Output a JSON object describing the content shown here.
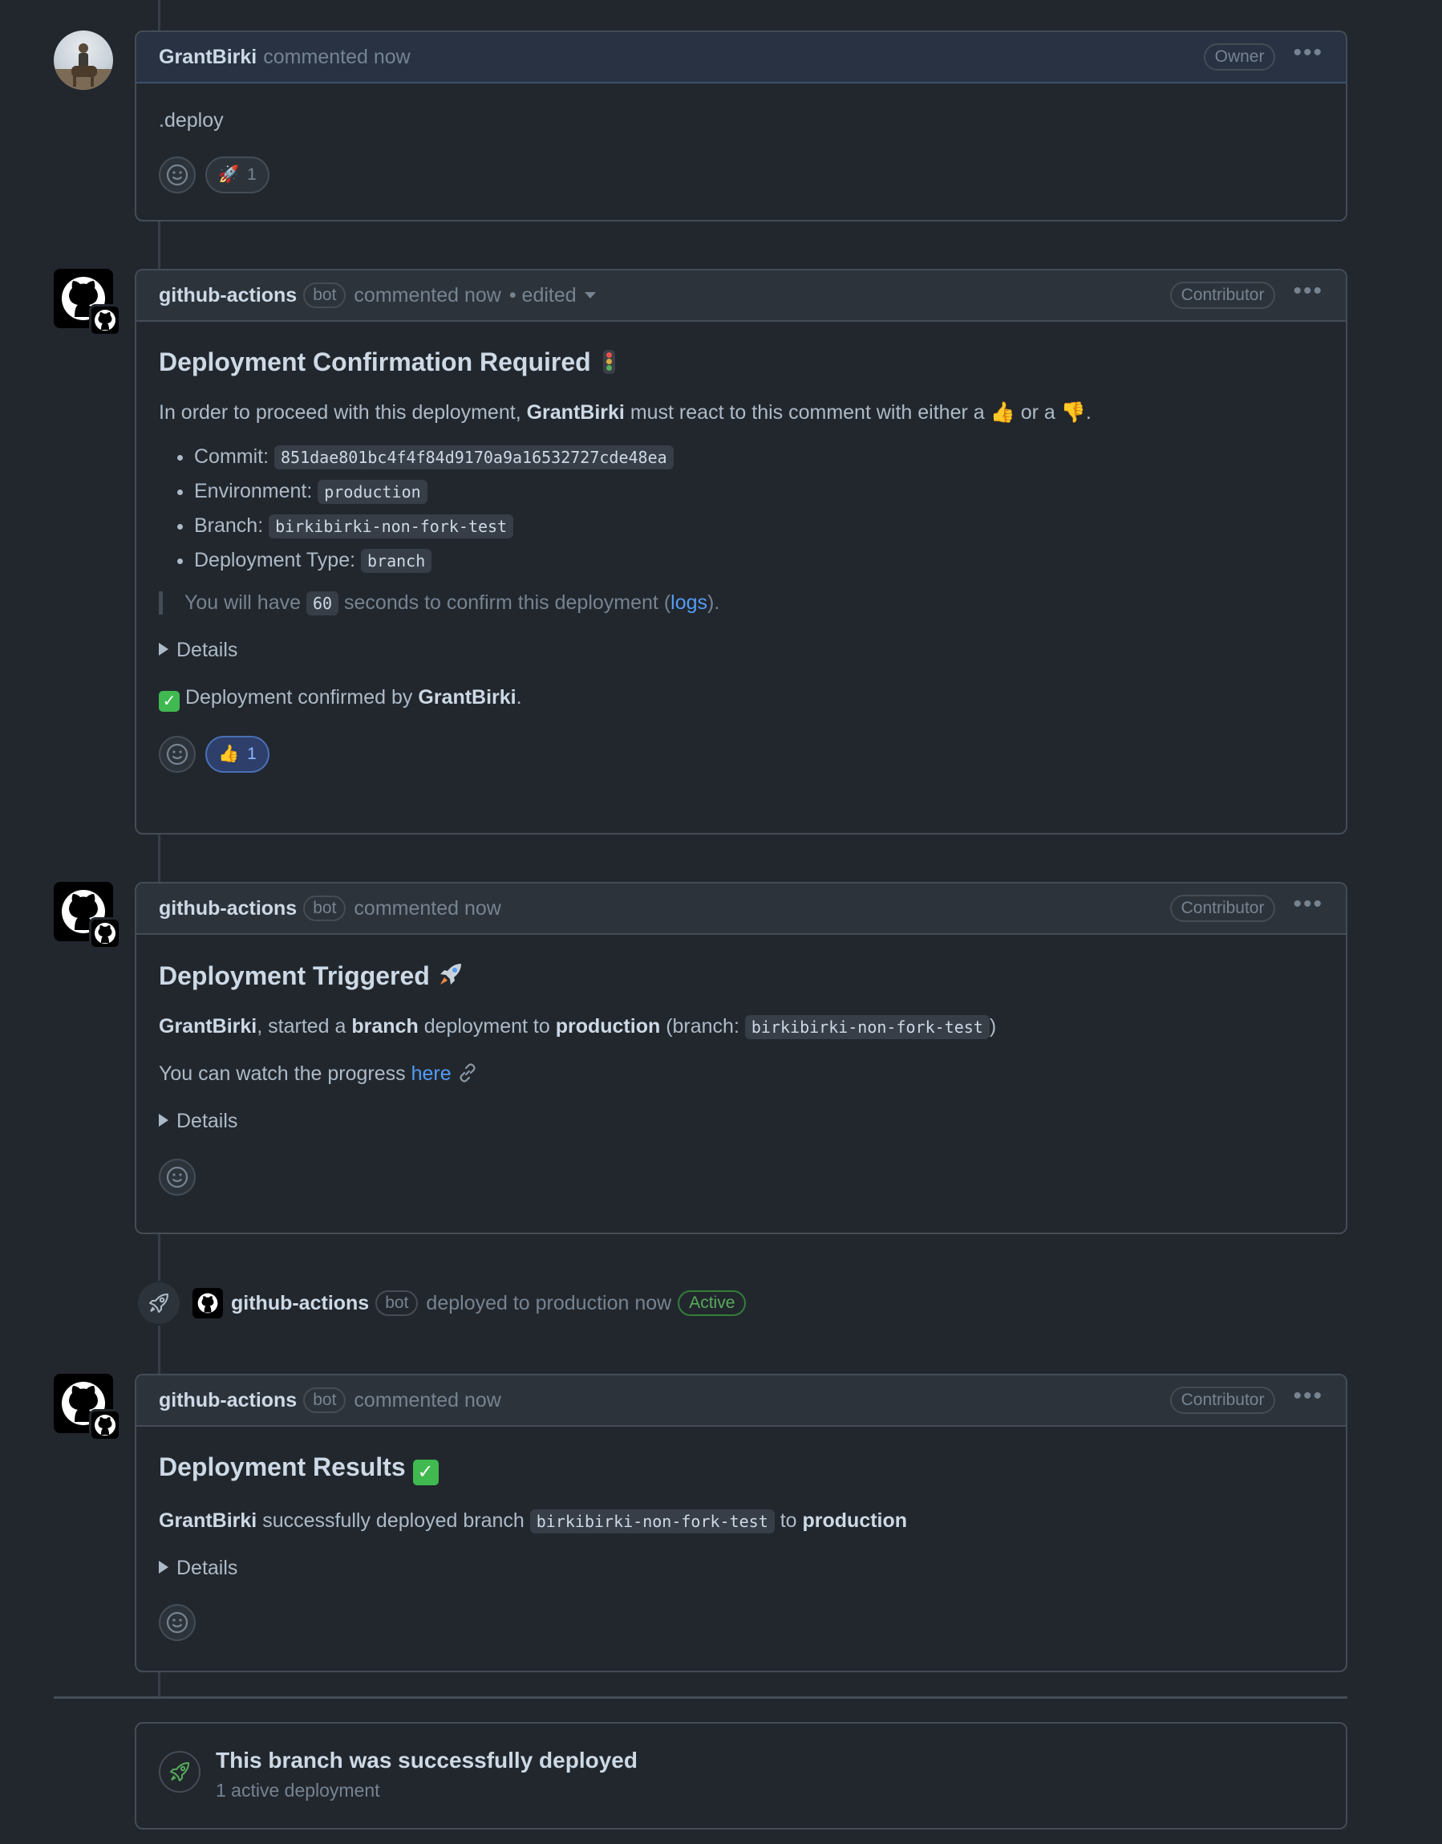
{
  "comments": [
    {
      "author": "GrantBirki",
      "meta": "commented now",
      "role": "Owner",
      "body_text": ".deploy",
      "reaction": {
        "emoji": "🚀",
        "count": "1"
      }
    },
    {
      "author": "github-actions",
      "bot_label": "bot",
      "meta": "commented now",
      "edited": "• edited",
      "role": "Contributor",
      "title": "Deployment Confirmation Required",
      "intro_prefix": "In order to proceed with this deployment,",
      "intro_user": "GrantBirki",
      "intro_mid": "must react to this comment with either a",
      "intro_up": "👍",
      "intro_or": "or a",
      "intro_down": "👎",
      "intro_end": ".",
      "facts": [
        {
          "label": "Commit:",
          "value": "851dae801bc4f4f84d9170a9a16532727cde48ea"
        },
        {
          "label": "Environment:",
          "value": "production"
        },
        {
          "label": "Branch:",
          "value": "birkibirki-non-fork-test"
        },
        {
          "label": "Deployment Type:",
          "value": "branch"
        }
      ],
      "quote_prefix": "You will have",
      "quote_seconds": "60",
      "quote_mid": "seconds to confirm this deployment (",
      "quote_link": "logs",
      "quote_end": ").",
      "details": "Details",
      "confirmed_prefix": "Deployment confirmed by",
      "confirmed_user": "GrantBirki",
      "confirmed_end": ".",
      "reaction": {
        "emoji": "👍",
        "count": "1"
      }
    },
    {
      "author": "github-actions",
      "bot_label": "bot",
      "meta": "commented now",
      "role": "Contributor",
      "title": "Deployment Triggered",
      "line_user": "GrantBirki",
      "line_a": ", started a",
      "line_type": "branch",
      "line_b": "deployment to",
      "line_env": "production",
      "line_c": "(branch:",
      "line_branch": "birkibirki-non-fork-test",
      "line_d": ")",
      "progress_prefix": "You can watch the progress",
      "progress_link": "here",
      "details": "Details"
    },
    {
      "author": "github-actions",
      "bot_label": "bot",
      "meta": "commented now",
      "role": "Contributor",
      "title": "Deployment Results",
      "line_user": "GrantBirki",
      "line_a": "successfully deployed branch",
      "line_branch": "birkibirki-non-fork-test",
      "line_b": "to",
      "line_env": "production",
      "details": "Details"
    }
  ],
  "event": {
    "actor": "github-actions",
    "bot_label": "bot",
    "text": "deployed to production now",
    "status": "Active"
  },
  "summary": {
    "title": "This branch was successfully deployed",
    "subtitle": "1 active deployment"
  },
  "kebab": "•••",
  "colors": {
    "link": "#539bf5",
    "success": "#57ab5a",
    "background": "#22272e"
  }
}
